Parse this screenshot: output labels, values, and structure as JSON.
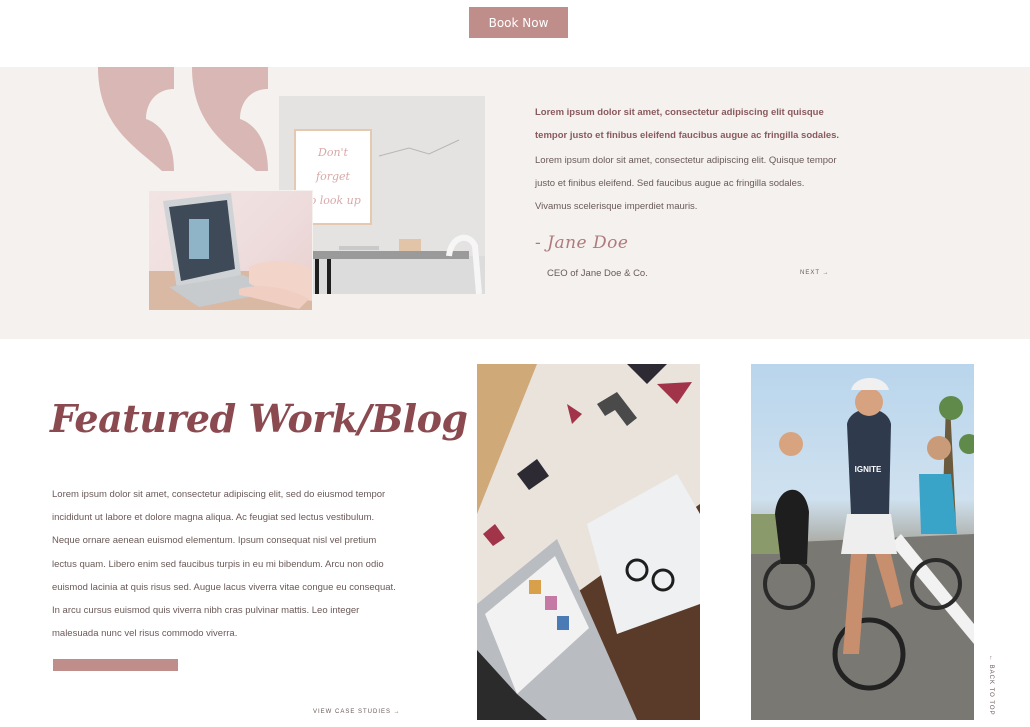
{
  "header": {
    "book_now": "Book Now"
  },
  "testimonial": {
    "lead": "Lorem ipsum dolor sit amet, consectetur adipiscing elit quisque tempor justo et finibus eleifend faucibus augue ac fringilla sodales.",
    "body": "Lorem ipsum dolor sit amet, consectetur adipiscing elit. Quisque tempor justo et finibus eleifend. Sed faucibus augue ac fringilla sodales. Vivamus scelerisque imperdiet mauris.",
    "signature": "- Jane Doe",
    "role": "CEO of Jane Doe & Co.",
    "next": "NEXT →",
    "poster_text": "Don't forget to look up"
  },
  "featured": {
    "title": "Featured Work/Blog",
    "body": "Lorem ipsum dolor sit amet, consectetur adipiscing elit, sed do eiusmod tempor incididunt ut labore et dolore magna aliqua. Ac feugiat sed lectus vestibulum. Neque ornare aenean euismod elementum. Ipsum consequat nisl vel pretium lectus quam. Libero enim sed faucibus turpis in eu mi bibendum. Arcu non odio euismod lacinia at quis risus sed. Augue lacus viverra vitae congue eu consequat. In arcu cursus euismod quis viverra nibh cras pulvinar mattis. Leo integer malesuada nunc vel risus commodo viverra.",
    "button_label": "",
    "view_link": "VIEW CASE STUDIES →"
  },
  "back_to_top": "← BACK TO TOP",
  "jersey_text": "IGNITE",
  "colors": {
    "accent": "#bf8d8a",
    "quote": "#d8b7b4",
    "section_bg": "#f4f1ef",
    "heading": "#8a4a50"
  }
}
